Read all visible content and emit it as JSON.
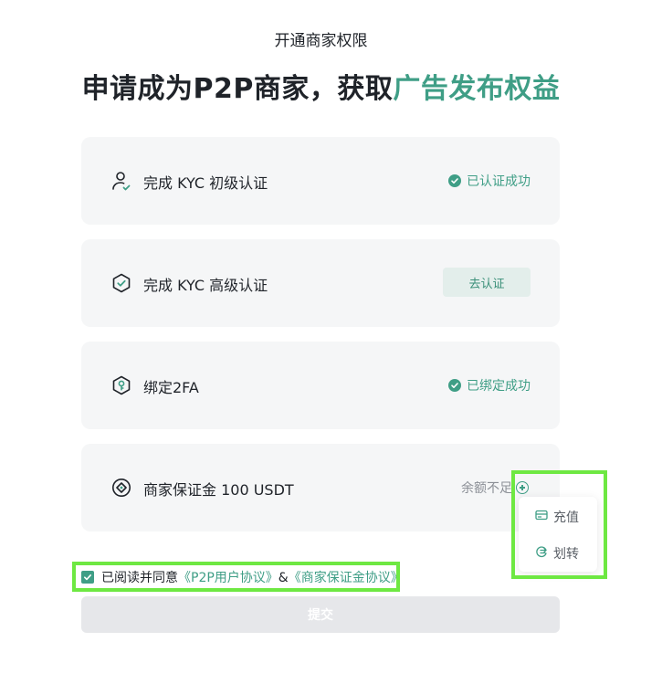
{
  "page_title": "开通商家权限",
  "headline": {
    "main": "申请成为P2P商家，获取",
    "accent": "广告发布权益"
  },
  "steps": [
    {
      "label": "完成 KYC 初级认证",
      "status": "已认证成功",
      "icon": "user-check-icon"
    },
    {
      "label": "完成 KYC 高级认证",
      "action": "去认证",
      "icon": "shield-check-icon"
    },
    {
      "label": "绑定2FA",
      "status": "已绑定成功",
      "icon": "shield-key-icon"
    },
    {
      "label": "商家保证金 100 USDT",
      "status": "余额不足",
      "icon": "diamond-coin-icon"
    }
  ],
  "popup_menu": {
    "items": [
      {
        "label": "充值",
        "icon": "deposit-card-icon"
      },
      {
        "label": "划转",
        "icon": "transfer-icon"
      }
    ]
  },
  "agreement": {
    "checked": true,
    "prefix": "已阅读并同意",
    "link1": "《P2P用户协议》",
    "separator": "&",
    "link2": "《商家保证金协议》"
  },
  "submit_label": "提交",
  "colors": {
    "accent": "#3f9e86",
    "card_bg": "#f5f6f7",
    "highlight": "#6ee842"
  }
}
